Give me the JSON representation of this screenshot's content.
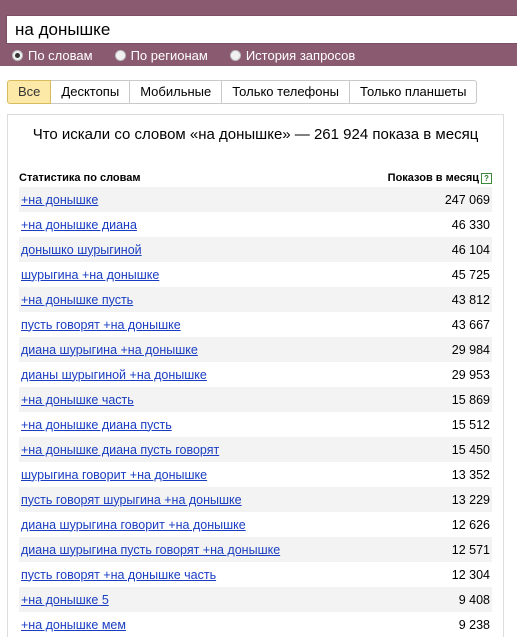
{
  "search": {
    "query": "на донышке",
    "modes": [
      {
        "label": "По словам",
        "checked": true
      },
      {
        "label": "По регионам",
        "checked": false
      },
      {
        "label": "История запросов",
        "checked": false
      }
    ]
  },
  "tabs": [
    "Все",
    "Десктопы",
    "Мобильные",
    "Только телефоны",
    "Только планшеты"
  ],
  "panel": {
    "title": "Что искали со словом «на донышке» — 261 924 показа в месяц",
    "col_words": "Статистика по словам",
    "col_shows": "Показов в месяц",
    "help_glyph": "?",
    "rows": [
      {
        "phrase": "+на донышке",
        "count": "247 069"
      },
      {
        "phrase": "+на донышке диана",
        "count": "46 330"
      },
      {
        "phrase": "донышко шурыгиной",
        "count": "46 104"
      },
      {
        "phrase": "шурыгина +на донышке",
        "count": "45 725"
      },
      {
        "phrase": "+на донышке пусть",
        "count": "43 812"
      },
      {
        "phrase": "пусть говорят +на донышке",
        "count": "43 667"
      },
      {
        "phrase": "диана шурыгина +на донышке",
        "count": "29 984"
      },
      {
        "phrase": "дианы шурыгиной +на донышке",
        "count": "29 953"
      },
      {
        "phrase": "+на донышке часть",
        "count": "15 869"
      },
      {
        "phrase": "+на донышке диана пусть",
        "count": "15 512"
      },
      {
        "phrase": "+на донышке диана пусть говорят",
        "count": "15 450"
      },
      {
        "phrase": "шурыгина говорит +на донышке",
        "count": "13 352"
      },
      {
        "phrase": "пусть говорят шурыгина +на донышке",
        "count": "13 229"
      },
      {
        "phrase": "диана шурыгина говорит +на донышке",
        "count": "12 626"
      },
      {
        "phrase": "диана шурыгина пусть говорят +на донышке",
        "count": "12 571"
      },
      {
        "phrase": "пусть говорят +на донышке часть",
        "count": "12 304"
      },
      {
        "phrase": "+на донышке 5",
        "count": "9 408"
      },
      {
        "phrase": "+на донышке мем",
        "count": "9 238"
      }
    ]
  },
  "colors": {
    "header_bg": "#8a5a71",
    "link": "#1a3dc1",
    "active_tab": "#fce9a8",
    "row_stripe": "#f3f3f3"
  }
}
